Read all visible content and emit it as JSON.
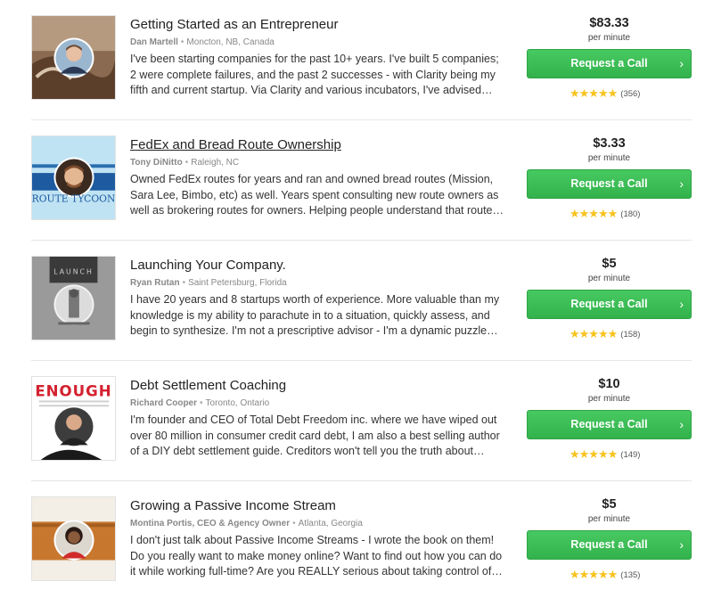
{
  "experts": [
    {
      "title": "Getting Started as an Entrepreneur",
      "author": "Dan Martell",
      "location": "Moncton, NB, Canada",
      "description": "I've been starting companies for the past 10+ years. I've built 5 companies; 2 were complete failures, and the past 2 successes - with Clarity being my fifth and current startup. Via Clarity and various incubators, I've advised…",
      "price": "$83.33",
      "per_label": "per minute",
      "button_label": "Request a Call",
      "stars": "★★★★★",
      "rating_count": "(356)"
    },
    {
      "title": "FedEx and Bread Route Ownership",
      "author": "Tony DiNitto",
      "location": "Raleigh, NC",
      "description": "Owned FedEx routes for years and ran and owned bread routes (Mission, Sara Lee, Bimbo, etc) as well. Years spent consulting new route owners as well as brokering routes for owners. Helping people understand that route…",
      "price": "$3.33",
      "per_label": "per minute",
      "button_label": "Request a Call",
      "stars": "★★★★★",
      "rating_count": "(180)",
      "thumb_text": "ROUTE TYCOON"
    },
    {
      "title": "Launching Your Company.",
      "author": "Ryan Rutan",
      "location": "Saint Petersburg, Florida",
      "description": "I have 20 years and 8 startups worth of experience. More valuable than my knowledge is my ability to parachute in to a situation, quickly assess, and begin to synthesize. I'm not a prescriptive advisor - I'm a dynamic puzzle…",
      "price": "$5",
      "per_label": "per minute",
      "button_label": "Request a Call",
      "stars": "★★★★★",
      "rating_count": "(158)",
      "thumb_text": "LAUNCH"
    },
    {
      "title": "Debt Settlement Coaching",
      "author": "Richard Cooper",
      "location": "Toronto, Ontario",
      "description": "I'm founder and CEO of Total Debt Freedom inc. where we have wiped out over 80 million in consumer credit card debt, I am also a best selling author of a DIY debt settlement guide. Creditors won't tell you the truth about…",
      "price": "$10",
      "per_label": "per minute",
      "button_label": "Request a Call",
      "stars": "★★★★★",
      "rating_count": "(149)",
      "thumb_text": "ENOUGH"
    },
    {
      "title": "Growing a Passive Income Stream",
      "author": "Montina Portis, CEO & Agency Owner",
      "location": "Atlanta, Georgia",
      "description": "I don't just talk about Passive Income Streams - I wrote the book on them! Do you really want to make money online? Want to find out how you can do it while working full-time? Are you REALLY serious about taking control of…",
      "price": "$5",
      "per_label": "per minute",
      "button_label": "Request a Call",
      "stars": "★★★★★",
      "rating_count": "(135)"
    }
  ]
}
